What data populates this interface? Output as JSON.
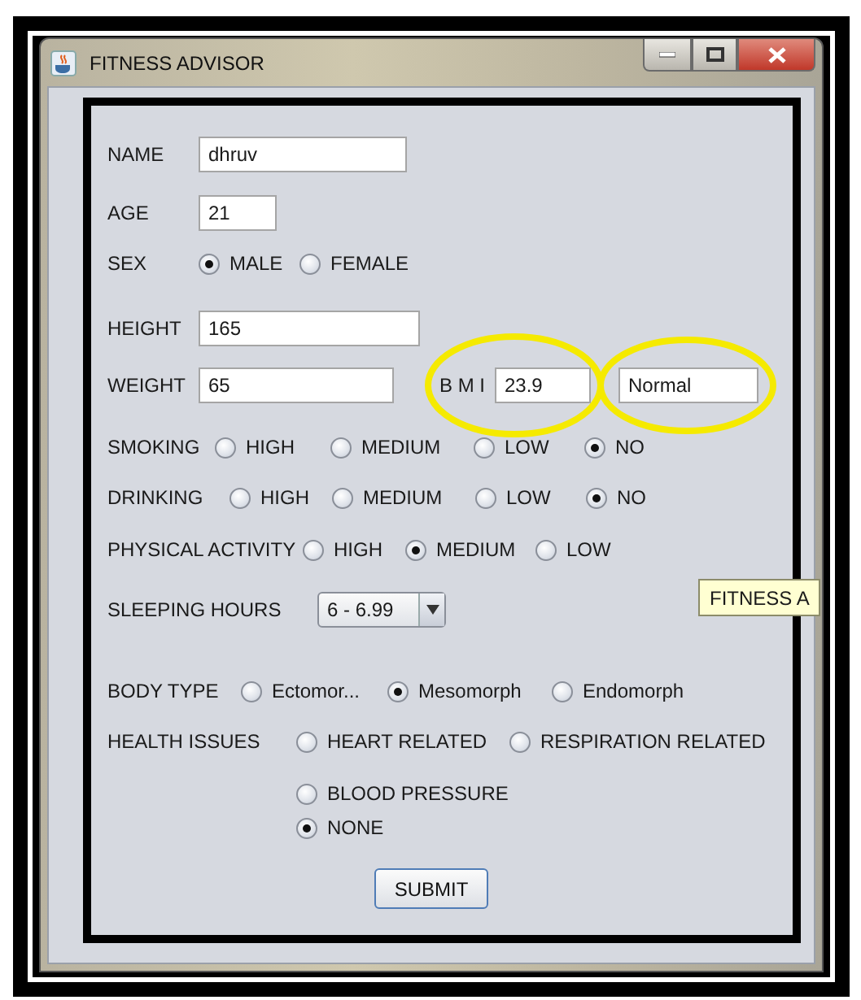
{
  "window": {
    "title": "FITNESS ADVISOR"
  },
  "form": {
    "name": {
      "label": "NAME",
      "value": "dhruv"
    },
    "age": {
      "label": "AGE",
      "value": "21"
    },
    "sex": {
      "label": "SEX",
      "options": [
        {
          "label": "MALE",
          "selected": true
        },
        {
          "label": "FEMALE",
          "selected": false
        }
      ]
    },
    "height": {
      "label": "HEIGHT",
      "value": "165"
    },
    "weight": {
      "label": "WEIGHT",
      "value": "65"
    },
    "bmi": {
      "label": "B M I",
      "value": "23.9",
      "category": "Normal"
    },
    "smoking": {
      "label": "SMOKING",
      "options": [
        {
          "label": "HIGH",
          "selected": false
        },
        {
          "label": "MEDIUM",
          "selected": false
        },
        {
          "label": "LOW",
          "selected": false
        },
        {
          "label": "NO",
          "selected": true
        }
      ]
    },
    "drinking": {
      "label": "DRINKING",
      "options": [
        {
          "label": "HIGH",
          "selected": false
        },
        {
          "label": "MEDIUM",
          "selected": false
        },
        {
          "label": "LOW",
          "selected": false
        },
        {
          "label": "NO",
          "selected": true
        }
      ]
    },
    "physical_activity": {
      "label": "PHYSICAL ACTIVITY",
      "options": [
        {
          "label": "HIGH",
          "selected": false
        },
        {
          "label": "MEDIUM",
          "selected": true
        },
        {
          "label": "LOW",
          "selected": false
        }
      ]
    },
    "sleeping_hours": {
      "label": "SLEEPING HOURS",
      "value": "6 - 6.99"
    },
    "body_type": {
      "label": "BODY TYPE",
      "options": [
        {
          "label": "Ectomor...",
          "selected": false
        },
        {
          "label": "Mesomorph",
          "selected": true
        },
        {
          "label": "Endomorph",
          "selected": false
        }
      ]
    },
    "health_issues": {
      "label": "HEALTH ISSUES",
      "options": [
        {
          "label": "HEART RELATED",
          "selected": false
        },
        {
          "label": "RESPIRATION RELATED",
          "selected": false
        },
        {
          "label": "BLOOD PRESSURE",
          "selected": false
        },
        {
          "label": "NONE",
          "selected": true
        }
      ]
    },
    "submit": "SUBMIT"
  },
  "tooltip": "FITNESS A"
}
